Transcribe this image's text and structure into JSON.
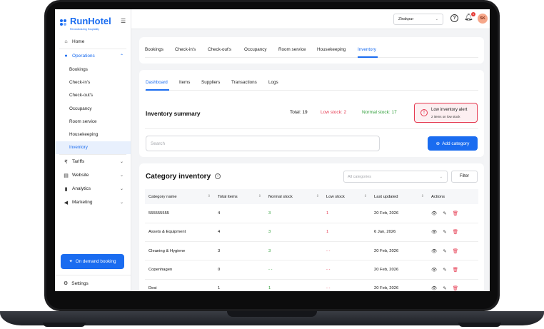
{
  "brand": {
    "name": "RunHotel",
    "tagline": "Revolutionizing Hospitality",
    "color": "#1a6cf0"
  },
  "sidebar": {
    "items": [
      {
        "label": "Home",
        "icon": "home-icon"
      },
      {
        "label": "Operations",
        "icon": "operations-icon",
        "expanded": true
      },
      {
        "label": "Tariffs",
        "icon": "tariffs-icon"
      },
      {
        "label": "Website",
        "icon": "website-icon"
      },
      {
        "label": "Analytics",
        "icon": "analytics-icon"
      },
      {
        "label": "Marketing",
        "icon": "marketing-icon"
      }
    ],
    "operations_sub": [
      "Bookings",
      "Check-in's",
      "Check-out's",
      "Occupancy",
      "Room service",
      "Housekeeping",
      "Inventory"
    ],
    "active_sub": "Inventory",
    "demand_button": "On demand booking",
    "settings": "Settings"
  },
  "topbar": {
    "location": "Zirakpur",
    "notification_count": "1",
    "avatar_initials": "SK"
  },
  "ops_tabs": [
    "Bookings",
    "Check-in's",
    "Check-out's",
    "Occupancy",
    "Room service",
    "Housekeeping",
    "Inventory"
  ],
  "inventory_tabs": [
    "Dashboard",
    "Items",
    "Suppliers",
    "Transactions",
    "Logs"
  ],
  "summary": {
    "title": "Inventory summary",
    "total": "Total: 19",
    "low": "Low stock: 2",
    "normal": "Normal stock: 17",
    "alert_title": "Low inventory alert",
    "alert_sub": "2 items on low stock"
  },
  "search": {
    "placeholder": "Search"
  },
  "add_category": "Add category",
  "category_inventory": {
    "title": "Category inventory",
    "filter_placeholder": "All categories",
    "filter_button": "Filter",
    "columns": [
      "Category name",
      "Total items",
      "Normal stock",
      "Low stock",
      "Last updated",
      "Actions"
    ],
    "rows": [
      {
        "name": "555555555",
        "total": "4",
        "normal": "3",
        "low": "1",
        "updated": "20 Feb, 2026"
      },
      {
        "name": "Assets & Equipment",
        "total": "4",
        "normal": "3",
        "low": "1",
        "updated": "6 Jan, 2026"
      },
      {
        "name": "Cleaning & Hygiene",
        "total": "3",
        "normal": "3",
        "low": "- -",
        "updated": "20 Feb, 2026"
      },
      {
        "name": "Copenhagen",
        "total": "0",
        "normal": "- -",
        "low": "- -",
        "updated": "20 Feb, 2026"
      },
      {
        "name": "Desi",
        "total": "1",
        "normal": "1",
        "low": "- -",
        "updated": "20 Feb, 2026"
      }
    ]
  },
  "colors": {
    "green": "#2e9e38",
    "red": "#e53950"
  }
}
